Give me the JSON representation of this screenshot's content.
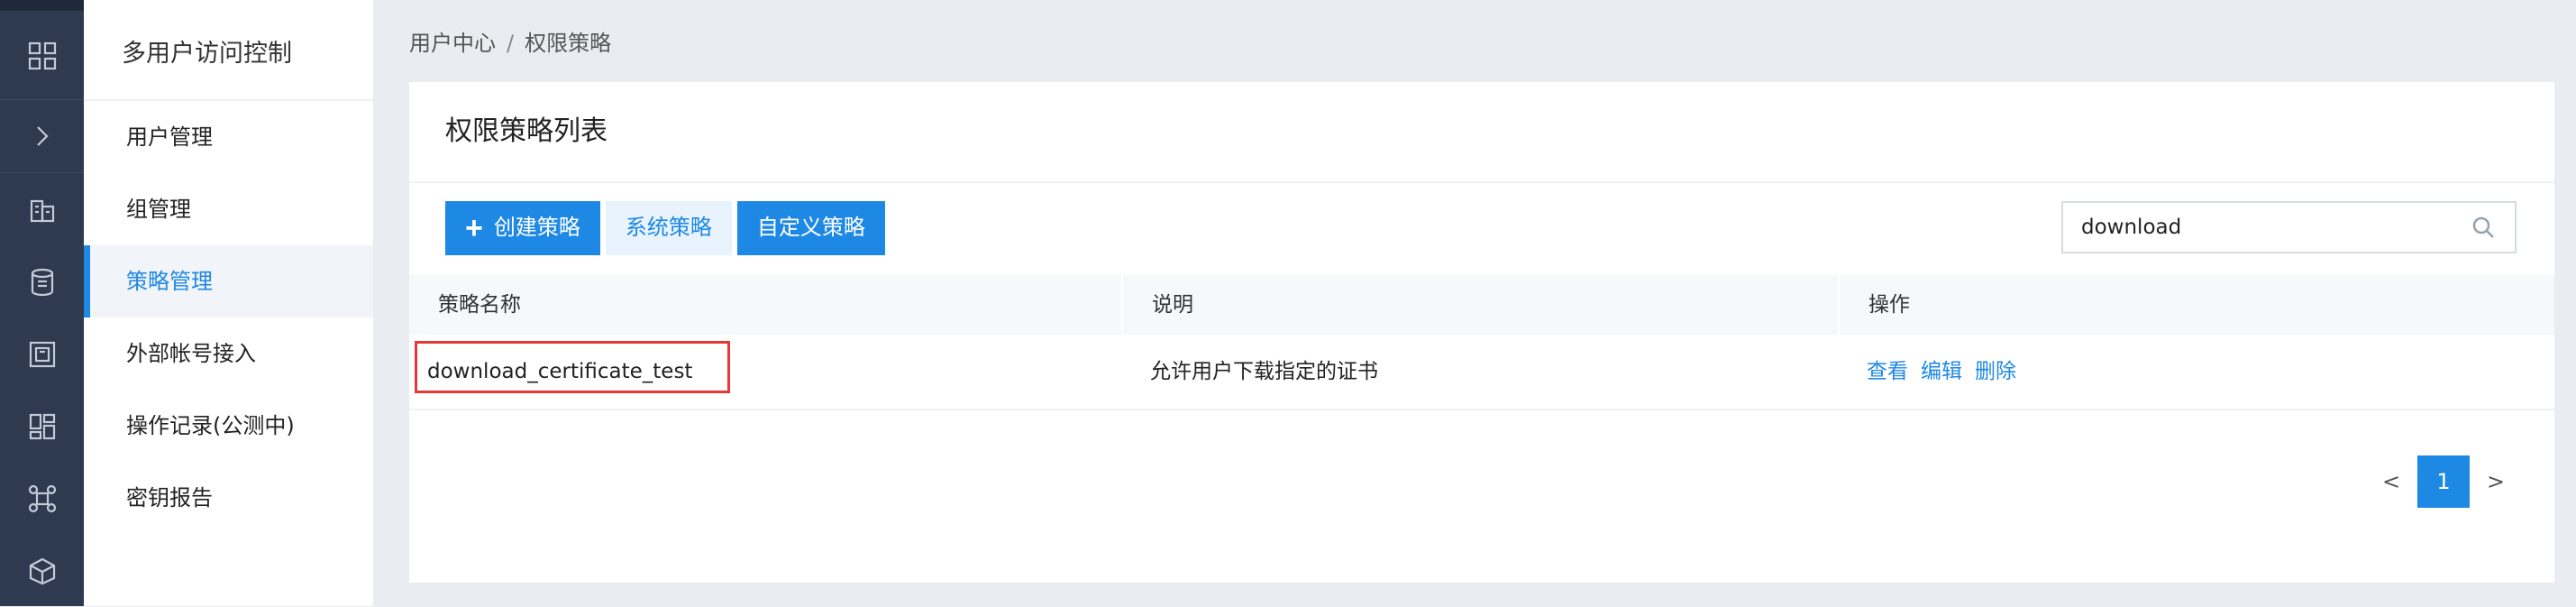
{
  "sidebar": {
    "title": "多用户访问控制",
    "items": [
      {
        "label": "用户管理"
      },
      {
        "label": "组管理"
      },
      {
        "label": "策略管理"
      },
      {
        "label": "外部帐号接入"
      },
      {
        "label": "操作记录(公测中)"
      },
      {
        "label": "密钥报告"
      }
    ],
    "active_index": 2
  },
  "breadcrumb": {
    "parent": "用户中心",
    "separator": "/",
    "current": "权限策略"
  },
  "card": {
    "title": "权限策略列表"
  },
  "toolbar": {
    "create_label": "创建策略",
    "system_label": "系统策略",
    "custom_label": "自定义策略"
  },
  "search": {
    "value": "download"
  },
  "table": {
    "headers": [
      "策略名称",
      "说明",
      "操作"
    ],
    "rows": [
      {
        "name": "download_certificate_test",
        "description": "允许用户下载指定的证书",
        "actions": [
          "查看",
          "编辑",
          "删除"
        ]
      }
    ]
  },
  "pagination": {
    "prev": "<",
    "current": "1",
    "next": ">"
  },
  "colors": {
    "accent": "#1e88e5",
    "rail": "#2e3a4f",
    "highlight": "#e53935"
  }
}
